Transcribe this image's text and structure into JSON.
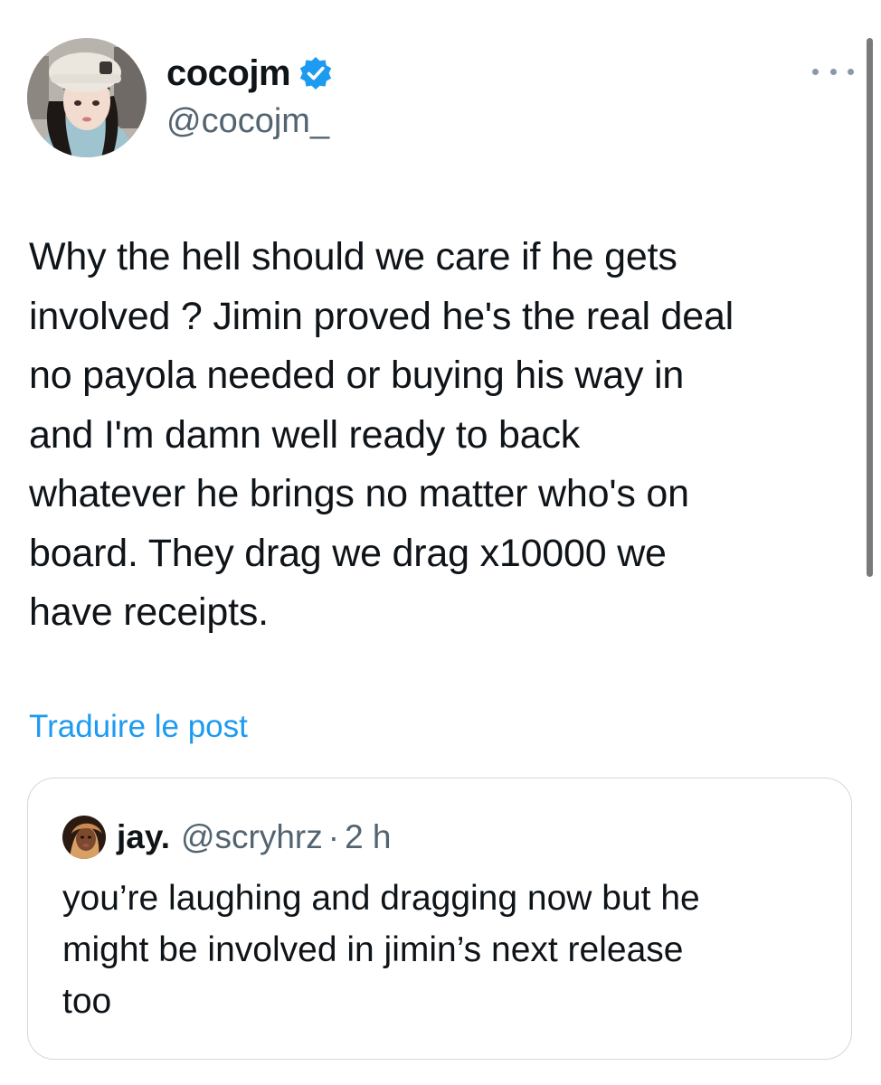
{
  "author": {
    "display_name": "cocojm",
    "handle": "@cocojm_",
    "verified_icon": "verified-badge-icon",
    "avatar_icon": "profile-photo"
  },
  "menu": {
    "icon": "more-options-icon"
  },
  "tweet": {
    "text": "Why the hell should we care if he gets\ninvolved ? Jimin proved he's the real deal\nno payola needed or buying his way in\nand I'm damn well ready to back\nwhatever he brings no matter who's on\nboard. They drag we drag x10000 we\nhave receipts.",
    "translate_label": "Traduire le post"
  },
  "quote": {
    "display_name": "jay.",
    "handle": "@scryhrz",
    "separator": "·",
    "time": "2 h",
    "text": "you’re laughing and dragging now but he\nmight be involved in jimin’s next release\ntoo"
  },
  "colors": {
    "accent": "#1d9bf0",
    "text": "#0f1419",
    "secondary": "#536471",
    "border": "#cfd9de"
  }
}
